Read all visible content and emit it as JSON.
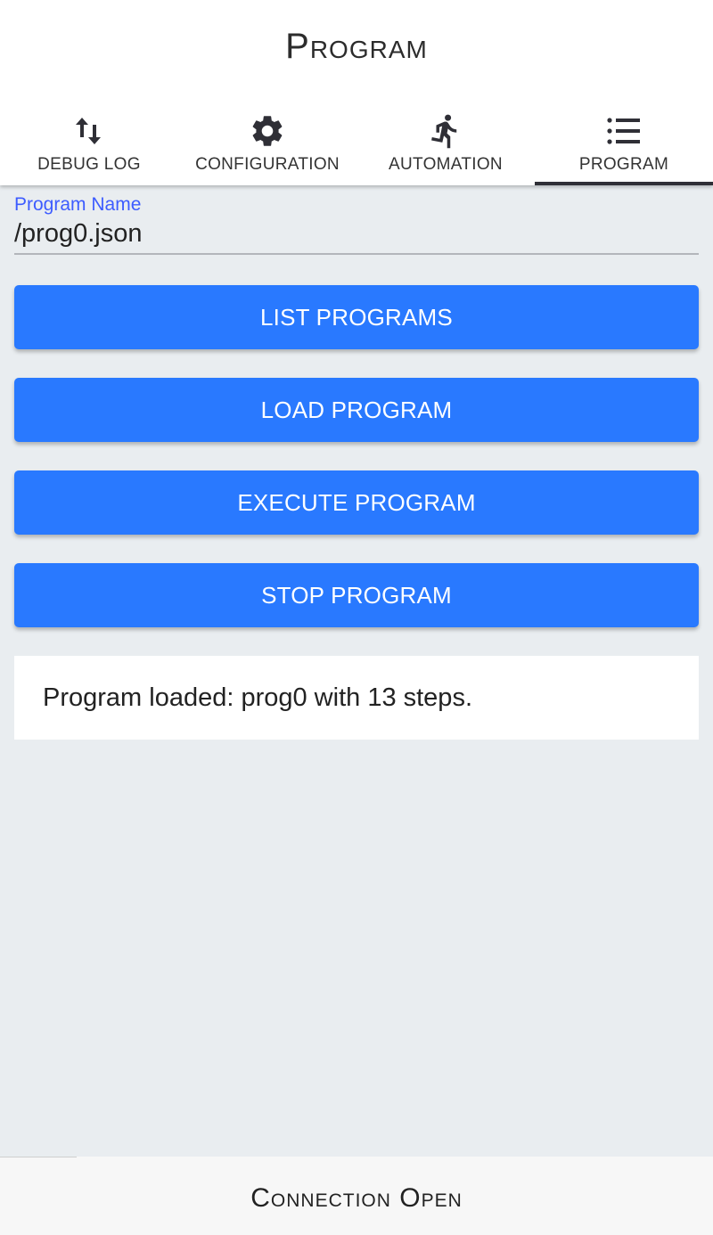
{
  "header": {
    "title": "Program"
  },
  "tabs": [
    {
      "label": "DEBUG LOG",
      "icon": "swap-vertical-icon",
      "active": false
    },
    {
      "label": "CONFIGURATION",
      "icon": "gear-icon",
      "active": false
    },
    {
      "label": "AUTOMATION",
      "icon": "running-person-icon",
      "active": false
    },
    {
      "label": "PROGRAM",
      "icon": "list-icon",
      "active": true
    }
  ],
  "program_field": {
    "label": "Program Name",
    "value": "/prog0.json"
  },
  "buttons": {
    "list": "LIST PROGRAMS",
    "load": "LOAD PROGRAM",
    "execute": "EXECUTE PROGRAM",
    "stop": "STOP PROGRAM"
  },
  "status": {
    "message": "Program loaded: prog0 with 13 steps."
  },
  "footer": {
    "connection": "Connection Open"
  },
  "colors": {
    "accent": "#2979ff",
    "label_blue": "#3d5cff",
    "background": "#e9edf0",
    "tab_indicator": "#2f2f36"
  }
}
